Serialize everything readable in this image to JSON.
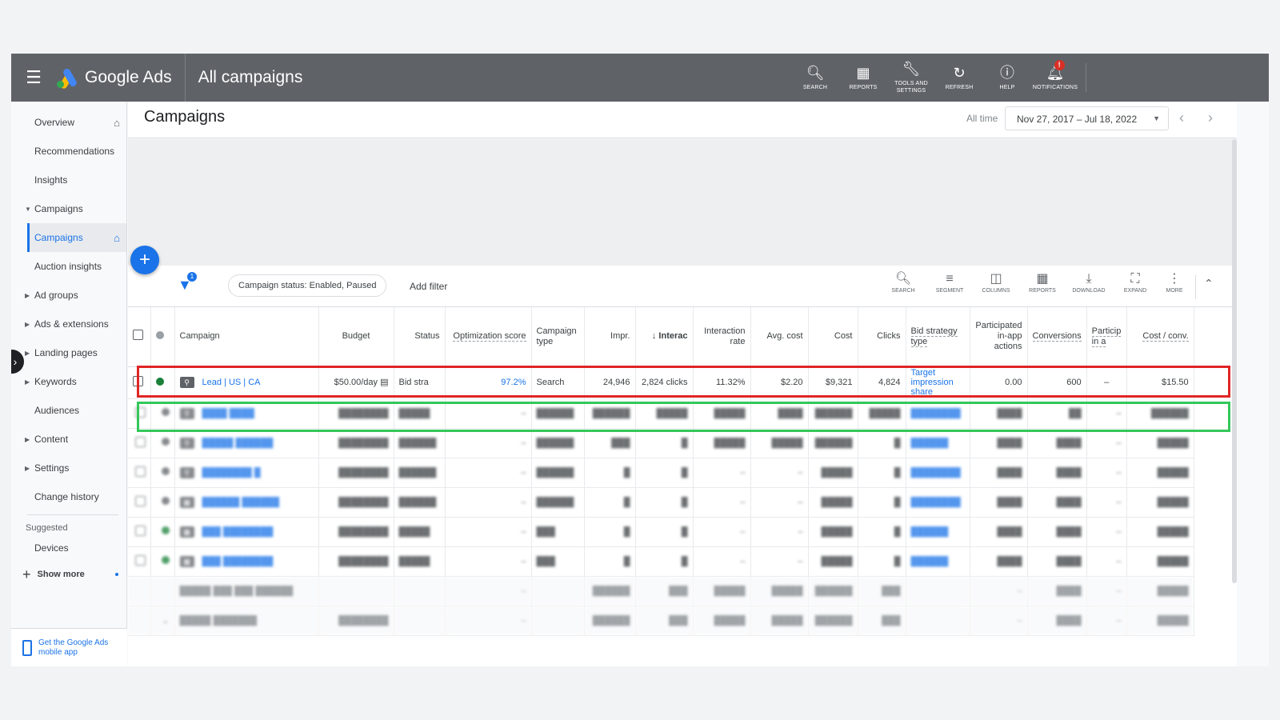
{
  "app": {
    "brand": "Google Ads",
    "page_title": "All campaigns"
  },
  "topbar": {
    "actions": [
      {
        "label": "SEARCH",
        "icon": "search-icon"
      },
      {
        "label": "REPORTS",
        "icon": "reports-icon"
      },
      {
        "label": "TOOLS AND SETTINGS",
        "icon": "wrench-icon"
      },
      {
        "label": "REFRESH",
        "icon": "refresh-icon"
      },
      {
        "label": "HELP",
        "icon": "help-icon"
      },
      {
        "label": "NOTIFICATIONS",
        "icon": "bell-icon",
        "badge": "!"
      }
    ]
  },
  "sidebar": {
    "items": [
      {
        "label": "Overview"
      },
      {
        "label": "Recommendations"
      },
      {
        "label": "Insights"
      },
      {
        "label": "Campaigns"
      },
      {
        "label": "Campaigns"
      },
      {
        "label": "Auction insights"
      },
      {
        "label": "Ad groups"
      },
      {
        "label": "Ads & extensions"
      },
      {
        "label": "Landing pages"
      },
      {
        "label": "Keywords"
      },
      {
        "label": "Audiences"
      },
      {
        "label": "Content"
      },
      {
        "label": "Settings"
      },
      {
        "label": "Change history"
      }
    ],
    "suggested_label": "Suggested",
    "suggested_item": "Devices",
    "show_more": "Show more",
    "mobile_app": "Get the Google Ads mobile app"
  },
  "header": {
    "title": "Campaigns",
    "all_time": "All time",
    "date_range": "Nov 27, 2017 – Jul 18, 2022"
  },
  "toolbar": {
    "filter_count": "1",
    "filter_chip": "Campaign status: Enabled, Paused",
    "add_filter": "Add filter",
    "tools": [
      {
        "label": "SEARCH",
        "icon": "search-icon"
      },
      {
        "label": "SEGMENT",
        "icon": "segment-icon"
      },
      {
        "label": "COLUMNS",
        "icon": "columns-icon"
      },
      {
        "label": "REPORTS",
        "icon": "reports-icon"
      },
      {
        "label": "DOWNLOAD",
        "icon": "download-icon"
      },
      {
        "label": "EXPAND",
        "icon": "expand-icon"
      },
      {
        "label": "MORE",
        "icon": "more-icon"
      }
    ]
  },
  "table": {
    "headers": [
      "Campaign",
      "Budget",
      "Status",
      "Optimization score",
      "Campaign type",
      "Impr.",
      "Interac",
      "Interaction rate",
      "Avg. cost",
      "Cost",
      "Clicks",
      "Bid strategy type",
      "Participated in-app actions",
      "Conversions",
      "Particip in a",
      "Cost / conv."
    ],
    "row1": {
      "status_color": "#188038",
      "campaign": "Lead | US | CA",
      "budget": "$50.00/day",
      "status": "Bid stra",
      "opt_score": "97.2%",
      "type": "Search",
      "impr": "24,946",
      "interactions": "2,824 clicks",
      "int_rate": "11.32%",
      "avg_cost": "$2.20",
      "cost": "$9,321",
      "clicks": "4,824",
      "bid_strategy": "Target impression share",
      "in_app": "0.00",
      "conversions": "600",
      "particip": "–",
      "cost_conv": "$15.50"
    }
  }
}
